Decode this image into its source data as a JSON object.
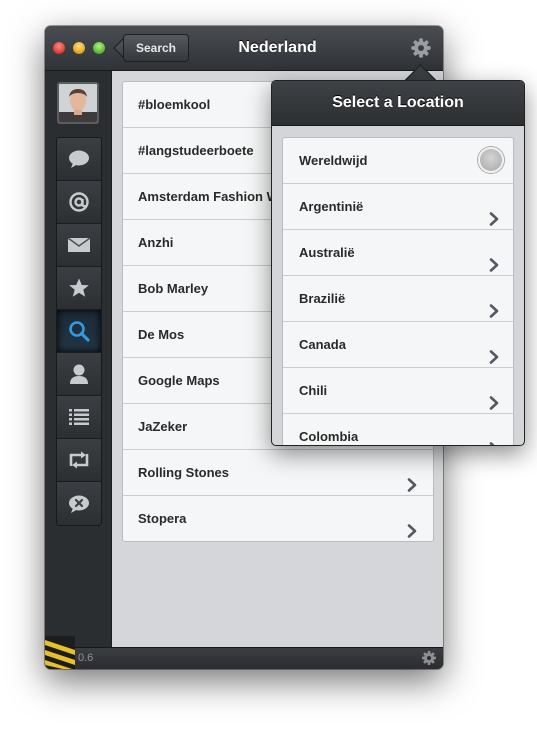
{
  "window": {
    "title": "Nederland",
    "back_label": "Search",
    "version": "0.6"
  },
  "sidebar": {
    "avatar_icon": "user-photo",
    "items": [
      {
        "name": "messages",
        "icon": "speech-bubble-icon"
      },
      {
        "name": "mentions",
        "icon": "at-sign-icon"
      },
      {
        "name": "direct-messages",
        "icon": "envelope-icon"
      },
      {
        "name": "favorites",
        "icon": "star-icon"
      },
      {
        "name": "search",
        "icon": "magnifier-icon",
        "active": true
      },
      {
        "name": "profile",
        "icon": "person-icon"
      },
      {
        "name": "lists",
        "icon": "list-icon"
      },
      {
        "name": "retweets",
        "icon": "retweet-icon"
      },
      {
        "name": "mute",
        "icon": "mute-bubble-icon"
      }
    ]
  },
  "trends": [
    "#bloemkool",
    "#langstudeerboete",
    "Amsterdam Fashion W",
    "Anzhi",
    "Bob Marley",
    "De Mos",
    "Google Maps",
    "JaZeker",
    "Rolling Stones",
    "Stopera"
  ],
  "popover": {
    "title": "Select a Location",
    "options": [
      {
        "label": "Wereldwijd",
        "type": "radio"
      },
      {
        "label": "Argentinië",
        "type": "chevron"
      },
      {
        "label": "Australië",
        "type": "chevron"
      },
      {
        "label": "Brazilië",
        "type": "chevron"
      },
      {
        "label": "Canada",
        "type": "chevron"
      },
      {
        "label": "Chili",
        "type": "chevron"
      },
      {
        "label": "Colombia",
        "type": "chevron"
      }
    ]
  },
  "colors": {
    "chrome": "#2b2e31",
    "content_bg": "#d4d6d9",
    "list_bg": "#f5f6f7",
    "active_icon": "#2f9be0"
  }
}
